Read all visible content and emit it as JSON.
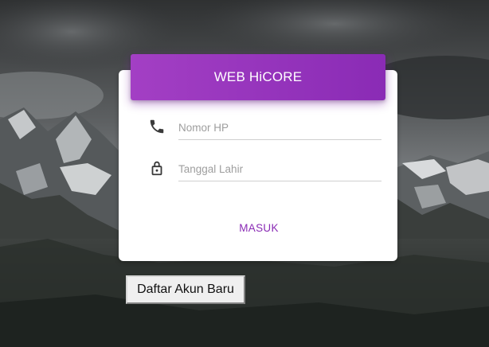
{
  "login": {
    "title": "WEB HiCORE",
    "phone": {
      "placeholder": "Nomor HP",
      "value": "",
      "icon": "phone-icon"
    },
    "birthdate": {
      "placeholder": "Tanggal Lahir",
      "value": "",
      "icon": "lock-icon"
    },
    "submit_label": "MASUK"
  },
  "register_label": "Daftar Akun Baru",
  "colors": {
    "accent": "#9b36bf",
    "link": "#8a2bb5",
    "card": "#ffffff",
    "icon": "#3a3a3a"
  },
  "background": "mountain-landscape-grayscale"
}
